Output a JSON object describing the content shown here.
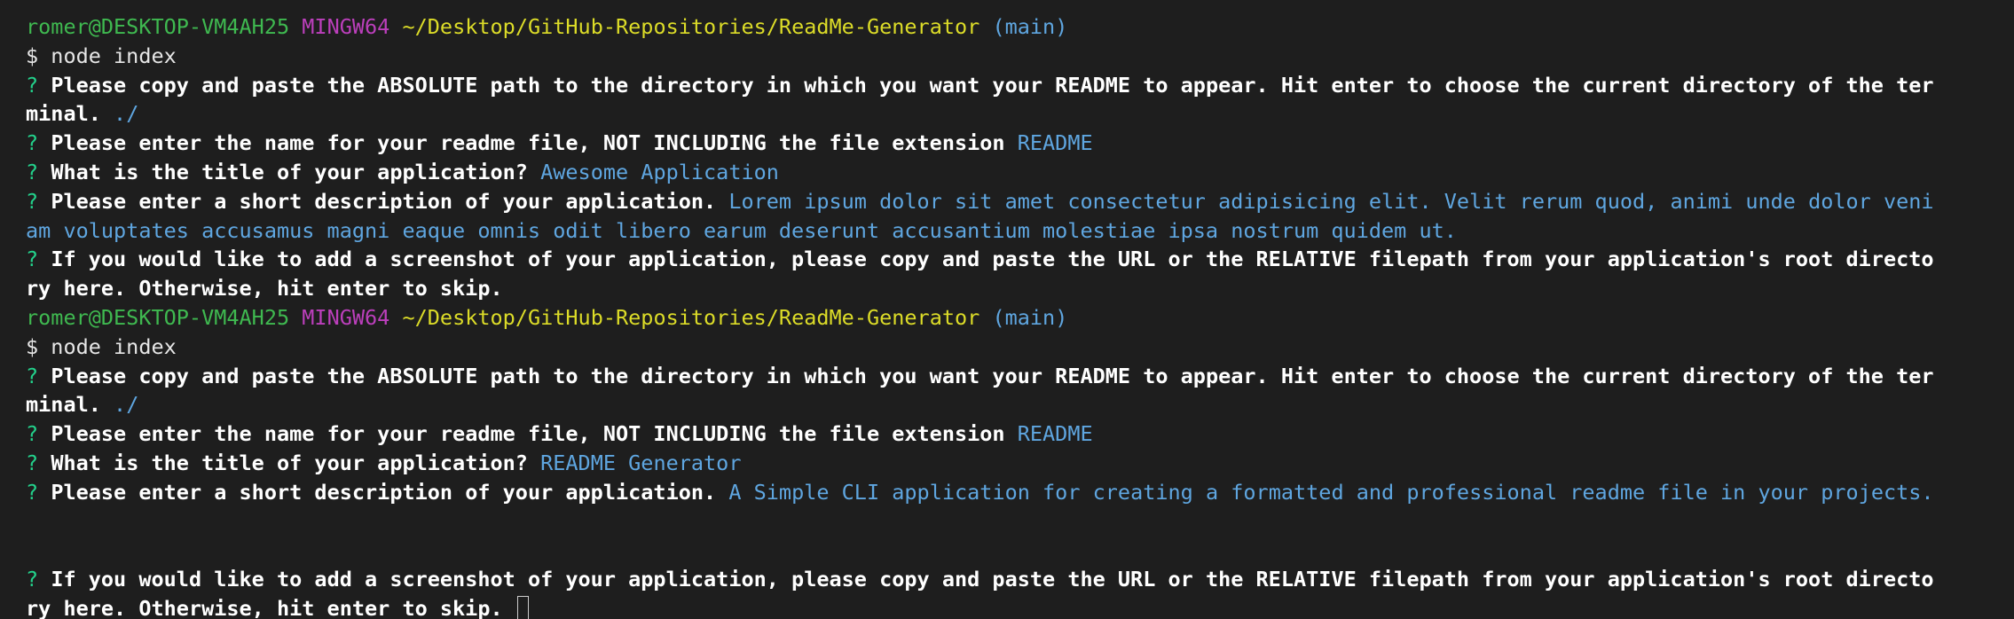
{
  "terminal": {
    "prompt1": {
      "user_host": "romer@DESKTOP-VM4AH25",
      "shell": "MINGW64",
      "path": "~/Desktop/GitHub-Repositories/ReadMe-Generator",
      "branch": "(main)",
      "command": "$ node index"
    },
    "session1": {
      "q_mark": "?",
      "q1_line1": "Please copy and paste the ABSOLUTE path to the directory in which you want your README to appear. Hit enter to choose the current directory of the ter",
      "q1_line2": "minal.",
      "a1": "./",
      "q2": "Please enter the name for your readme file, NOT INCLUDING the file extension",
      "a2": "README",
      "q3": "What is the title of your application?",
      "a3": "Awesome Application",
      "q4": "Please enter a short description of your application.",
      "a4_line1": "Lorem ipsum dolor sit amet consectetur adipisicing elit. Velit rerum quod, animi unde dolor veni",
      "a4_line2": "am voluptates accusamus magni eaque omnis odit libero earum deserunt accusantium molestiae ipsa nostrum quidem ut.",
      "q5_line1": "If you would like to add a screenshot of your application, please copy and paste the URL or the RELATIVE filepath from your application's root directo",
      "q5_line2": "ry here. Otherwise, hit enter to skip."
    },
    "prompt2": {
      "user_host": "romer@DESKTOP-VM4AH25",
      "shell": "MINGW64",
      "path": "~/Desktop/GitHub-Repositories/ReadMe-Generator",
      "branch": "(main)",
      "command": "$ node index"
    },
    "session2": {
      "q_mark": "?",
      "q1_line1": "Please copy and paste the ABSOLUTE path to the directory in which you want your README to appear. Hit enter to choose the current directory of the ter",
      "q1_line2": "minal.",
      "a1": "./",
      "q2": "Please enter the name for your readme file, NOT INCLUDING the file extension",
      "a2": "README",
      "q3": "What is the title of your application?",
      "a3": "README Generator",
      "q4": "Please enter a short description of your application.",
      "a4": "A Simple CLI application for creating a formatted and professional readme file in your projects.",
      "q5_line1": "If you would like to add a screenshot of your application, please copy and paste the URL or the RELATIVE filepath from your application's root directo",
      "q5_line2": "ry here. Otherwise, hit enter to skip."
    },
    "colors": {
      "background": "#1e1e1e",
      "user_host": "#3fb950",
      "shell": "#bc3fbc",
      "path": "#dcdc28",
      "branch": "#5fa6e0",
      "answer": "#5fa6e0"
    }
  }
}
